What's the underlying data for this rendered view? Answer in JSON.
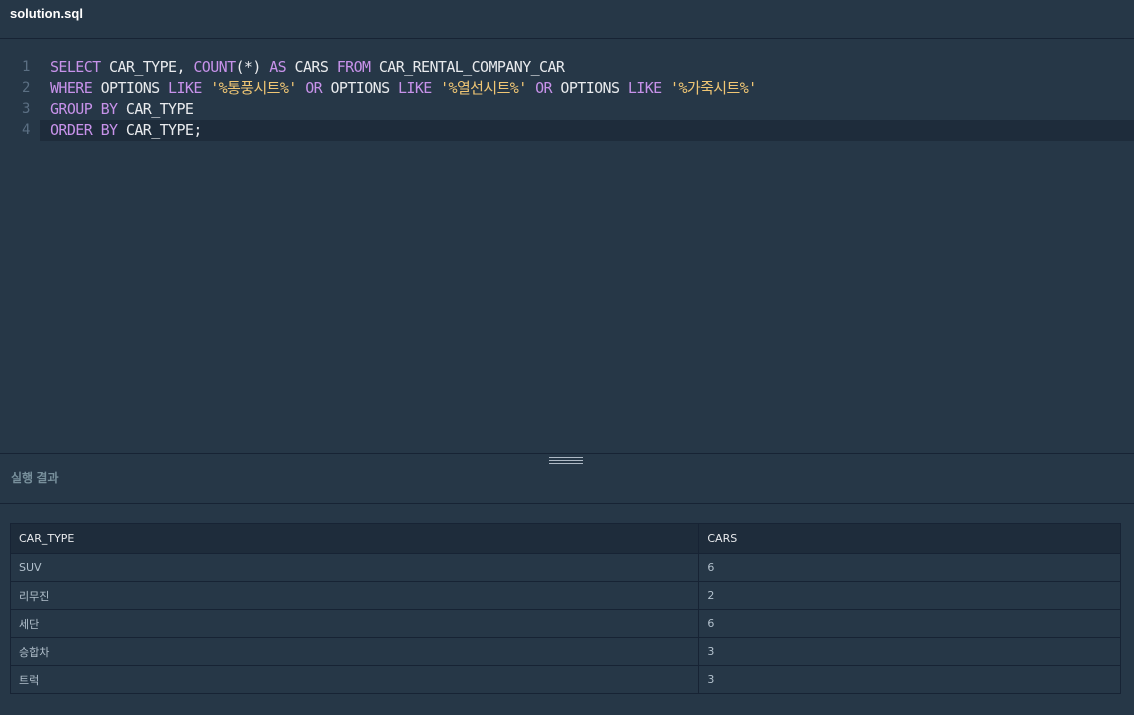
{
  "file": {
    "name": "solution.sql"
  },
  "editor": {
    "lines": [
      {
        "number": "1",
        "tokens": [
          {
            "t": "SELECT",
            "c": "kw"
          },
          {
            "t": " CAR_TYPE, ",
            "c": "id"
          },
          {
            "t": "COUNT",
            "c": "kw"
          },
          {
            "t": "(*) ",
            "c": "id"
          },
          {
            "t": "AS",
            "c": "kw"
          },
          {
            "t": " CARS ",
            "c": "id"
          },
          {
            "t": "FROM",
            "c": "kw"
          },
          {
            "t": " CAR_RENTAL_COMPANY_CAR",
            "c": "id"
          }
        ]
      },
      {
        "number": "2",
        "tokens": [
          {
            "t": "WHERE",
            "c": "kw"
          },
          {
            "t": " OPTIONS ",
            "c": "id"
          },
          {
            "t": "LIKE",
            "c": "kw"
          },
          {
            "t": " ",
            "c": "id"
          },
          {
            "t": "'%통풍시트%'",
            "c": "str"
          },
          {
            "t": " ",
            "c": "id"
          },
          {
            "t": "OR",
            "c": "kw"
          },
          {
            "t": " OPTIONS ",
            "c": "id"
          },
          {
            "t": "LIKE",
            "c": "kw"
          },
          {
            "t": " ",
            "c": "id"
          },
          {
            "t": "'%열선시트%'",
            "c": "str"
          },
          {
            "t": " ",
            "c": "id"
          },
          {
            "t": "OR",
            "c": "kw"
          },
          {
            "t": " OPTIONS ",
            "c": "id"
          },
          {
            "t": "LIKE",
            "c": "kw"
          },
          {
            "t": " ",
            "c": "id"
          },
          {
            "t": "'%가죽시트%'",
            "c": "str"
          }
        ]
      },
      {
        "number": "3",
        "tokens": [
          {
            "t": "GROUP",
            "c": "kw"
          },
          {
            "t": " ",
            "c": "id"
          },
          {
            "t": "BY",
            "c": "kw"
          },
          {
            "t": " CAR_TYPE",
            "c": "id"
          }
        ]
      },
      {
        "number": "4",
        "tokens": [
          {
            "t": "ORDER",
            "c": "kw"
          },
          {
            "t": " ",
            "c": "id"
          },
          {
            "t": "BY",
            "c": "kw"
          },
          {
            "t": " CAR_TYPE;",
            "c": "id"
          }
        ]
      }
    ],
    "active_line": 3,
    "colors": {
      "keyword": "#c792ea",
      "string": "#f0c674",
      "identifier": "#e8eaed",
      "background": "#263747"
    }
  },
  "result": {
    "title": "실행 결과",
    "columns": [
      "CAR_TYPE",
      "CARS"
    ],
    "rows": [
      [
        "SUV",
        "6"
      ],
      [
        "리무진",
        "2"
      ],
      [
        "세단",
        "6"
      ],
      [
        "승합차",
        "3"
      ],
      [
        "트럭",
        "3"
      ]
    ]
  }
}
